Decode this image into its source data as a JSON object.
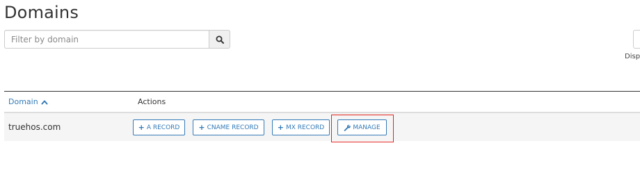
{
  "page": {
    "title": "Domains"
  },
  "search": {
    "placeholder": "Filter by domain",
    "value": "",
    "button_icon": "search-icon"
  },
  "display": {
    "label": "Displ"
  },
  "table": {
    "columns": [
      {
        "label": "Domain",
        "sort": "ascending",
        "sort_icon": "chevron-up-icon"
      },
      {
        "label": "Actions"
      }
    ],
    "rows": [
      {
        "domain": "truehos.com",
        "actions": [
          {
            "icon": "plus-icon",
            "label": "A RECORD"
          },
          {
            "icon": "plus-icon",
            "label": "CNAME RECORD"
          },
          {
            "icon": "plus-icon",
            "label": "MX RECORD"
          },
          {
            "icon": "wrench-icon",
            "label": "MANAGE"
          }
        ]
      }
    ]
  },
  "colors": {
    "link": "#337ab7",
    "row_background": "#f5f5f5",
    "highlight": "#e2231a"
  }
}
